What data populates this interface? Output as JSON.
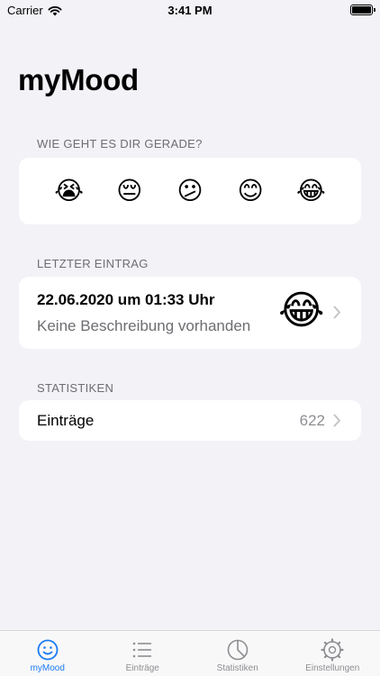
{
  "status": {
    "carrier": "Carrier",
    "time": "3:41 PM"
  },
  "title": "myMood",
  "mood_section": {
    "header": "WIE GEHT ES DIR GERADE?",
    "options": [
      "😭",
      "😔",
      "😕",
      "😊",
      "😂"
    ]
  },
  "last_entry": {
    "header": "LETZTER EINTRAG",
    "date": "22.06.2020 um 01:33 Uhr",
    "description": "Keine Beschreibung vorhanden",
    "emoji": "😂"
  },
  "stats": {
    "header": "STATISTIKEN",
    "entries_label": "Einträge",
    "entries_count": "622"
  },
  "tabs": [
    {
      "label": "myMood",
      "icon": "smiley-icon"
    },
    {
      "label": "Einträge",
      "icon": "list-icon"
    },
    {
      "label": "Statistiken",
      "icon": "pie-chart-icon"
    },
    {
      "label": "Einstellungen",
      "icon": "gear-icon"
    }
  ],
  "colors": {
    "accent": "#1a7cf5",
    "background": "#f2f2f7",
    "secondary_text": "#6d6d72"
  }
}
